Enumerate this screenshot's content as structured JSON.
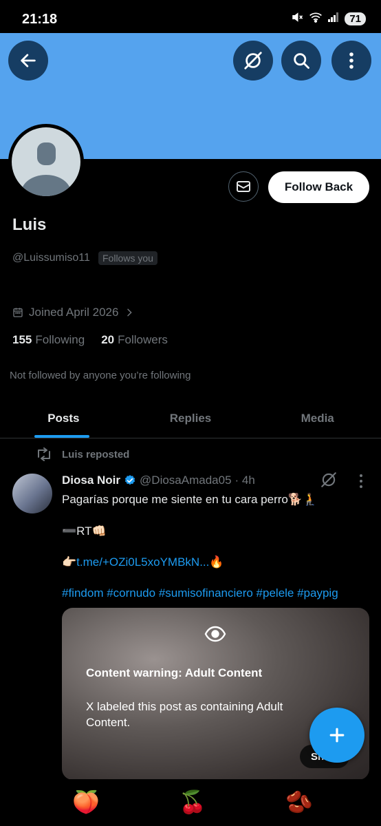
{
  "status": {
    "time": "21:18",
    "battery": "71"
  },
  "profile": {
    "name": "Luis",
    "handle": "@Luissumiso11",
    "follows_you": "Follows you",
    "follow_back": "Follow Back",
    "joined": "Joined April 2026",
    "following_count": "155",
    "following_label": "Following",
    "followers_count": "20",
    "followers_label": "Followers",
    "not_followed": "Not followed by anyone you’re following"
  },
  "tabs": [
    "Posts",
    "Replies",
    "Media"
  ],
  "post": {
    "repost_label": "Luis reposted",
    "author": "Diosa Noir",
    "handle": "@DiosaAmada05",
    "time": "· 4h",
    "line1": "Pagarías porque me siente en tu cara perro🐕🧎",
    "line2": "➖RT👊🏻",
    "line3_prefix": "👉🏻",
    "line3_link": "t.me/+OZi0L5xoYMBkN...",
    "line3_suffix": "🔥",
    "hashtags": "#findom #cornudo #sumisofinanciero #pelele #paypig",
    "warning_title": "Content warning: Adult Content",
    "warning_text": "X labeled this post as containing Adult Content.",
    "show_label": "Show"
  },
  "nav_emojis": [
    "🍑",
    "🍒",
    "🫘"
  ],
  "colors": {
    "banner": "#55a3ee",
    "accent": "#1d9bf0",
    "background": "#000000"
  }
}
